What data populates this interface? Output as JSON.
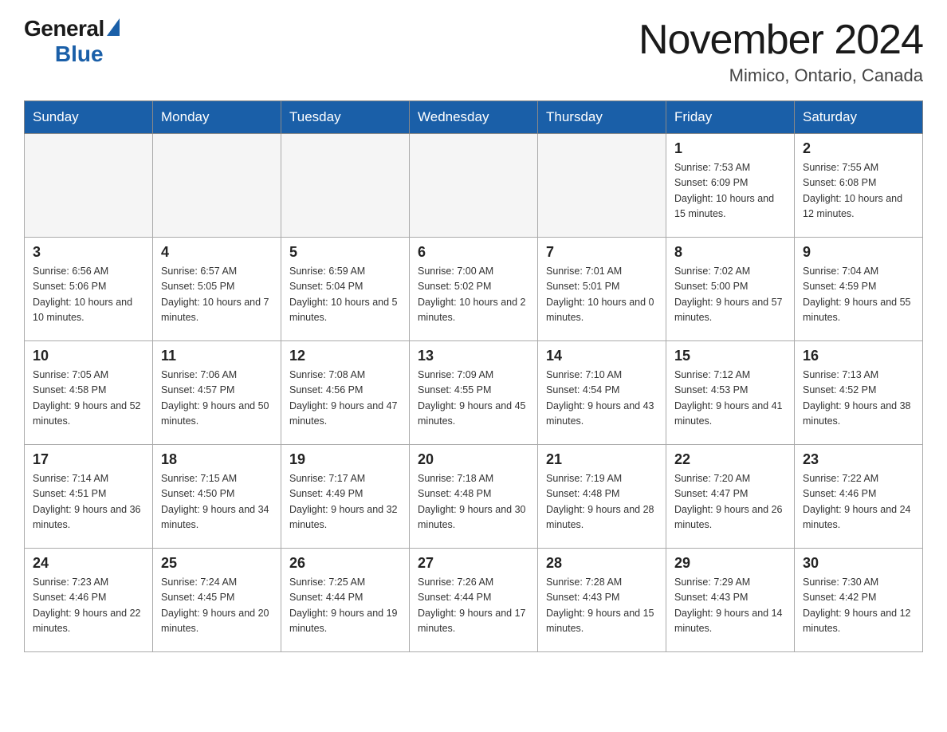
{
  "header": {
    "logo_general": "General",
    "logo_blue": "Blue",
    "month_title": "November 2024",
    "location": "Mimico, Ontario, Canada"
  },
  "weekdays": [
    "Sunday",
    "Monday",
    "Tuesday",
    "Wednesday",
    "Thursday",
    "Friday",
    "Saturday"
  ],
  "rows": [
    [
      {
        "day": "",
        "empty": true
      },
      {
        "day": "",
        "empty": true
      },
      {
        "day": "",
        "empty": true
      },
      {
        "day": "",
        "empty": true
      },
      {
        "day": "",
        "empty": true
      },
      {
        "day": "1",
        "sunrise": "Sunrise: 7:53 AM",
        "sunset": "Sunset: 6:09 PM",
        "daylight": "Daylight: 10 hours and 15 minutes."
      },
      {
        "day": "2",
        "sunrise": "Sunrise: 7:55 AM",
        "sunset": "Sunset: 6:08 PM",
        "daylight": "Daylight: 10 hours and 12 minutes."
      }
    ],
    [
      {
        "day": "3",
        "sunrise": "Sunrise: 6:56 AM",
        "sunset": "Sunset: 5:06 PM",
        "daylight": "Daylight: 10 hours and 10 minutes."
      },
      {
        "day": "4",
        "sunrise": "Sunrise: 6:57 AM",
        "sunset": "Sunset: 5:05 PM",
        "daylight": "Daylight: 10 hours and 7 minutes."
      },
      {
        "day": "5",
        "sunrise": "Sunrise: 6:59 AM",
        "sunset": "Sunset: 5:04 PM",
        "daylight": "Daylight: 10 hours and 5 minutes."
      },
      {
        "day": "6",
        "sunrise": "Sunrise: 7:00 AM",
        "sunset": "Sunset: 5:02 PM",
        "daylight": "Daylight: 10 hours and 2 minutes."
      },
      {
        "day": "7",
        "sunrise": "Sunrise: 7:01 AM",
        "sunset": "Sunset: 5:01 PM",
        "daylight": "Daylight: 10 hours and 0 minutes."
      },
      {
        "day": "8",
        "sunrise": "Sunrise: 7:02 AM",
        "sunset": "Sunset: 5:00 PM",
        "daylight": "Daylight: 9 hours and 57 minutes."
      },
      {
        "day": "9",
        "sunrise": "Sunrise: 7:04 AM",
        "sunset": "Sunset: 4:59 PM",
        "daylight": "Daylight: 9 hours and 55 minutes."
      }
    ],
    [
      {
        "day": "10",
        "sunrise": "Sunrise: 7:05 AM",
        "sunset": "Sunset: 4:58 PM",
        "daylight": "Daylight: 9 hours and 52 minutes."
      },
      {
        "day": "11",
        "sunrise": "Sunrise: 7:06 AM",
        "sunset": "Sunset: 4:57 PM",
        "daylight": "Daylight: 9 hours and 50 minutes."
      },
      {
        "day": "12",
        "sunrise": "Sunrise: 7:08 AM",
        "sunset": "Sunset: 4:56 PM",
        "daylight": "Daylight: 9 hours and 47 minutes."
      },
      {
        "day": "13",
        "sunrise": "Sunrise: 7:09 AM",
        "sunset": "Sunset: 4:55 PM",
        "daylight": "Daylight: 9 hours and 45 minutes."
      },
      {
        "day": "14",
        "sunrise": "Sunrise: 7:10 AM",
        "sunset": "Sunset: 4:54 PM",
        "daylight": "Daylight: 9 hours and 43 minutes."
      },
      {
        "day": "15",
        "sunrise": "Sunrise: 7:12 AM",
        "sunset": "Sunset: 4:53 PM",
        "daylight": "Daylight: 9 hours and 41 minutes."
      },
      {
        "day": "16",
        "sunrise": "Sunrise: 7:13 AM",
        "sunset": "Sunset: 4:52 PM",
        "daylight": "Daylight: 9 hours and 38 minutes."
      }
    ],
    [
      {
        "day": "17",
        "sunrise": "Sunrise: 7:14 AM",
        "sunset": "Sunset: 4:51 PM",
        "daylight": "Daylight: 9 hours and 36 minutes."
      },
      {
        "day": "18",
        "sunrise": "Sunrise: 7:15 AM",
        "sunset": "Sunset: 4:50 PM",
        "daylight": "Daylight: 9 hours and 34 minutes."
      },
      {
        "day": "19",
        "sunrise": "Sunrise: 7:17 AM",
        "sunset": "Sunset: 4:49 PM",
        "daylight": "Daylight: 9 hours and 32 minutes."
      },
      {
        "day": "20",
        "sunrise": "Sunrise: 7:18 AM",
        "sunset": "Sunset: 4:48 PM",
        "daylight": "Daylight: 9 hours and 30 minutes."
      },
      {
        "day": "21",
        "sunrise": "Sunrise: 7:19 AM",
        "sunset": "Sunset: 4:48 PM",
        "daylight": "Daylight: 9 hours and 28 minutes."
      },
      {
        "day": "22",
        "sunrise": "Sunrise: 7:20 AM",
        "sunset": "Sunset: 4:47 PM",
        "daylight": "Daylight: 9 hours and 26 minutes."
      },
      {
        "day": "23",
        "sunrise": "Sunrise: 7:22 AM",
        "sunset": "Sunset: 4:46 PM",
        "daylight": "Daylight: 9 hours and 24 minutes."
      }
    ],
    [
      {
        "day": "24",
        "sunrise": "Sunrise: 7:23 AM",
        "sunset": "Sunset: 4:46 PM",
        "daylight": "Daylight: 9 hours and 22 minutes."
      },
      {
        "day": "25",
        "sunrise": "Sunrise: 7:24 AM",
        "sunset": "Sunset: 4:45 PM",
        "daylight": "Daylight: 9 hours and 20 minutes."
      },
      {
        "day": "26",
        "sunrise": "Sunrise: 7:25 AM",
        "sunset": "Sunset: 4:44 PM",
        "daylight": "Daylight: 9 hours and 19 minutes."
      },
      {
        "day": "27",
        "sunrise": "Sunrise: 7:26 AM",
        "sunset": "Sunset: 4:44 PM",
        "daylight": "Daylight: 9 hours and 17 minutes."
      },
      {
        "day": "28",
        "sunrise": "Sunrise: 7:28 AM",
        "sunset": "Sunset: 4:43 PM",
        "daylight": "Daylight: 9 hours and 15 minutes."
      },
      {
        "day": "29",
        "sunrise": "Sunrise: 7:29 AM",
        "sunset": "Sunset: 4:43 PM",
        "daylight": "Daylight: 9 hours and 14 minutes."
      },
      {
        "day": "30",
        "sunrise": "Sunrise: 7:30 AM",
        "sunset": "Sunset: 4:42 PM",
        "daylight": "Daylight: 9 hours and 12 minutes."
      }
    ]
  ]
}
